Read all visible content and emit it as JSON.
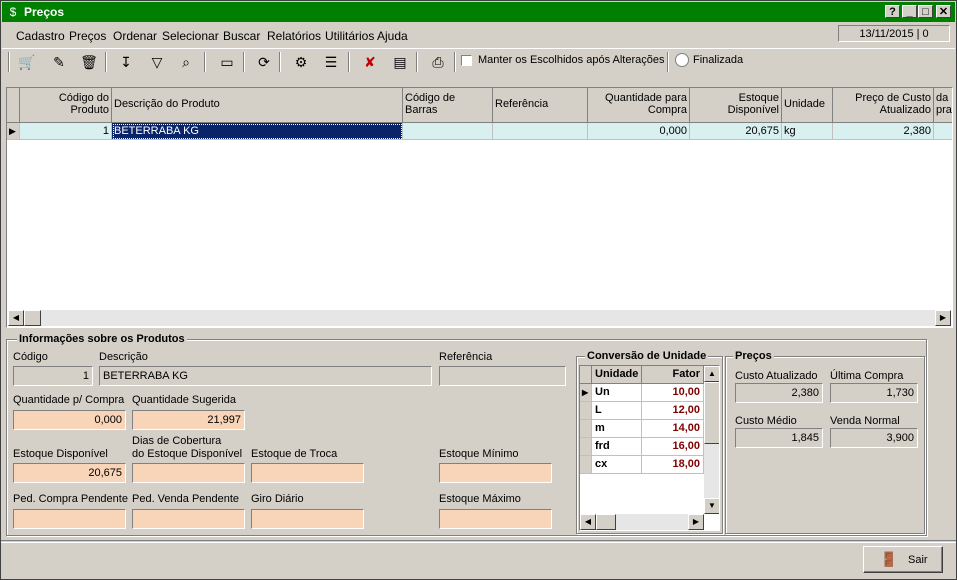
{
  "window": {
    "title": "Preços",
    "app_icon": "dollar-icon",
    "help_btn": "?",
    "min_btn": "_",
    "max_btn": "□",
    "close_btn": "✕"
  },
  "menu": [
    "Cadastro",
    "Preços",
    "Ordenar",
    "Selecionar",
    "Buscar",
    "Relatórios",
    "Utilitários",
    "Ajuda"
  ],
  "status_date": "13/11/2015 | 0",
  "toolbar": {
    "keep_selected_label": "Manter os Escolhidos após Alterações",
    "finalizada_label": "Finalizada"
  },
  "grid": {
    "headers": [
      "Código do Produto",
      "Descrição do Produto",
      "Código de Barras",
      "Referência",
      "Quantidade para Compra",
      "Estoque Disponível",
      "Unidade",
      "Preço de Custo Atualizado",
      "da pra"
    ],
    "row": {
      "codigo": "1",
      "descricao": "BETERRABA KG",
      "barras": "",
      "referencia": "",
      "qtd_compra": "0,000",
      "estoque": "20,675",
      "unidade": "kg",
      "preco_custo": "2,380"
    }
  },
  "info": {
    "title": "Informações sobre os Produtos",
    "codigo_label": "Código",
    "codigo": "1",
    "descricao_label": "Descrição",
    "descricao": "BETERRABA KG",
    "referencia_label": "Referência",
    "referencia": "",
    "qtd_compra_label": "Quantidade p/ Compra",
    "qtd_compra": "0,000",
    "qtd_sugerida_label": "Quantidade Sugerida",
    "qtd_sugerida": "21,997",
    "estoque_disp_label": "Estoque Disponível",
    "estoque_disp": "20,675",
    "dias_cobertura_label1": "Dias de Cobertura",
    "dias_cobertura_label2": "do Estoque Disponível",
    "dias_cobertura": "",
    "estoque_troca_label": "Estoque de Troca",
    "estoque_troca": "",
    "estoque_min_label": "Estoque Mínimo",
    "estoque_min": "",
    "ped_compra_label": "Ped. Compra Pendente",
    "ped_compra": "",
    "ped_venda_label": "Ped. Venda Pendente",
    "ped_venda": "",
    "giro_label": "Giro Diário",
    "giro": "",
    "estoque_max_label": "Estoque Máximo",
    "estoque_max": ""
  },
  "conversao": {
    "title": "Conversão de Unidade",
    "headers": [
      "Unidade",
      "Fator"
    ],
    "rows": [
      {
        "unidade": "Un",
        "fator": "10,00"
      },
      {
        "unidade": "L",
        "fator": "12,00"
      },
      {
        "unidade": "m",
        "fator": "14,00"
      },
      {
        "unidade": "frd",
        "fator": "16,00"
      },
      {
        "unidade": "cx",
        "fator": "18,00"
      }
    ]
  },
  "precos": {
    "title": "Preços",
    "custo_atual_label": "Custo Atualizado",
    "custo_atual": "2,380",
    "ultima_compra_label": "Última Compra",
    "ultima_compra": "1,730",
    "custo_medio_label": "Custo Médio",
    "custo_medio": "1,845",
    "venda_normal_label": "Venda Normal",
    "venda_normal": "3,900"
  },
  "sair_label": "Sair",
  "colors": {
    "titlebar": "#008000",
    "selected": "#0a246a",
    "pink_field": "#f8d4b8",
    "fator_text": "#800000"
  }
}
